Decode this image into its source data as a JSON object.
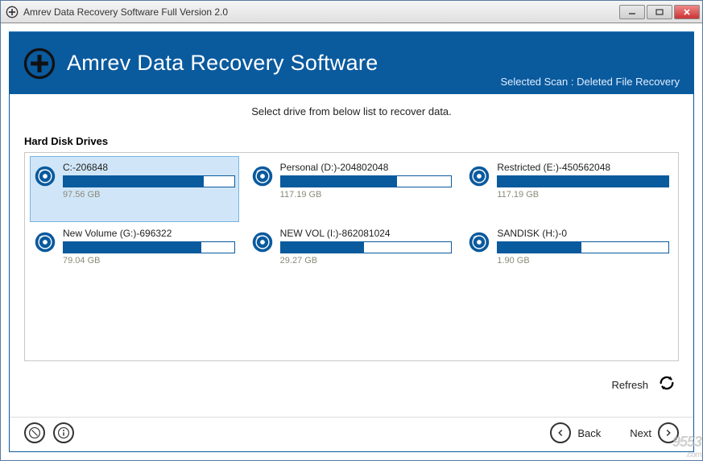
{
  "titlebar": {
    "text": "Amrev Data Recovery Software Full Version 2.0"
  },
  "header": {
    "title": "Amrev Data Recovery Software",
    "scan_label": "Selected Scan : Deleted File Recovery"
  },
  "main": {
    "instruction": "Select drive from below list to recover data.",
    "section_label": "Hard Disk Drives"
  },
  "drives": [
    {
      "name": "C:-206848",
      "size": "97.56 GB",
      "fill": 82,
      "selected": true
    },
    {
      "name": "Personal (D:)-204802048",
      "size": "117.19 GB",
      "fill": 68,
      "selected": false
    },
    {
      "name": "Restricted (E:)-450562048",
      "size": "117.19 GB",
      "fill": 100,
      "selected": false
    },
    {
      "name": "New Volume (G:)-696322",
      "size": "79.04 GB",
      "fill": 81,
      "selected": false
    },
    {
      "name": "NEW VOL (I:)-862081024",
      "size": "29.27 GB",
      "fill": 49,
      "selected": false
    },
    {
      "name": "SANDISK (H:)-0",
      "size": "1.90 GB",
      "fill": 49,
      "selected": false
    }
  ],
  "footer": {
    "refresh_label": "Refresh",
    "back_label": "Back",
    "next_label": "Next"
  },
  "watermark": {
    "main": "9553",
    "sub": ".com"
  }
}
